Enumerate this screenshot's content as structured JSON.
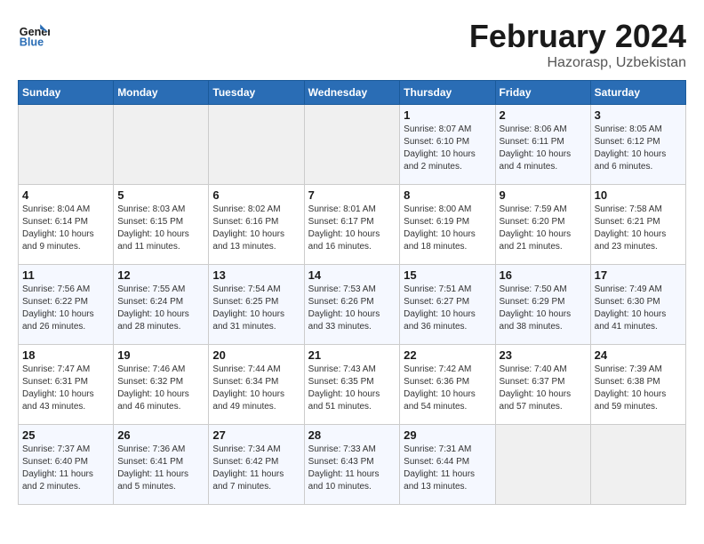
{
  "header": {
    "logo_general": "General",
    "logo_blue": "Blue",
    "month_title": "February 2024",
    "location": "Hazorasp, Uzbekistan"
  },
  "columns": [
    "Sunday",
    "Monday",
    "Tuesday",
    "Wednesday",
    "Thursday",
    "Friday",
    "Saturday"
  ],
  "weeks": [
    {
      "days": [
        {
          "num": "",
          "info": "",
          "empty": true
        },
        {
          "num": "",
          "info": "",
          "empty": true
        },
        {
          "num": "",
          "info": "",
          "empty": true
        },
        {
          "num": "",
          "info": "",
          "empty": true
        },
        {
          "num": "1",
          "info": "Sunrise: 8:07 AM\nSunset: 6:10 PM\nDaylight: 10 hours and 2 minutes."
        },
        {
          "num": "2",
          "info": "Sunrise: 8:06 AM\nSunset: 6:11 PM\nDaylight: 10 hours and 4 minutes."
        },
        {
          "num": "3",
          "info": "Sunrise: 8:05 AM\nSunset: 6:12 PM\nDaylight: 10 hours and 6 minutes."
        }
      ]
    },
    {
      "days": [
        {
          "num": "4",
          "info": "Sunrise: 8:04 AM\nSunset: 6:14 PM\nDaylight: 10 hours and 9 minutes."
        },
        {
          "num": "5",
          "info": "Sunrise: 8:03 AM\nSunset: 6:15 PM\nDaylight: 10 hours and 11 minutes."
        },
        {
          "num": "6",
          "info": "Sunrise: 8:02 AM\nSunset: 6:16 PM\nDaylight: 10 hours and 13 minutes."
        },
        {
          "num": "7",
          "info": "Sunrise: 8:01 AM\nSunset: 6:17 PM\nDaylight: 10 hours and 16 minutes."
        },
        {
          "num": "8",
          "info": "Sunrise: 8:00 AM\nSunset: 6:19 PM\nDaylight: 10 hours and 18 minutes."
        },
        {
          "num": "9",
          "info": "Sunrise: 7:59 AM\nSunset: 6:20 PM\nDaylight: 10 hours and 21 minutes."
        },
        {
          "num": "10",
          "info": "Sunrise: 7:58 AM\nSunset: 6:21 PM\nDaylight: 10 hours and 23 minutes."
        }
      ]
    },
    {
      "days": [
        {
          "num": "11",
          "info": "Sunrise: 7:56 AM\nSunset: 6:22 PM\nDaylight: 10 hours and 26 minutes."
        },
        {
          "num": "12",
          "info": "Sunrise: 7:55 AM\nSunset: 6:24 PM\nDaylight: 10 hours and 28 minutes."
        },
        {
          "num": "13",
          "info": "Sunrise: 7:54 AM\nSunset: 6:25 PM\nDaylight: 10 hours and 31 minutes."
        },
        {
          "num": "14",
          "info": "Sunrise: 7:53 AM\nSunset: 6:26 PM\nDaylight: 10 hours and 33 minutes."
        },
        {
          "num": "15",
          "info": "Sunrise: 7:51 AM\nSunset: 6:27 PM\nDaylight: 10 hours and 36 minutes."
        },
        {
          "num": "16",
          "info": "Sunrise: 7:50 AM\nSunset: 6:29 PM\nDaylight: 10 hours and 38 minutes."
        },
        {
          "num": "17",
          "info": "Sunrise: 7:49 AM\nSunset: 6:30 PM\nDaylight: 10 hours and 41 minutes."
        }
      ]
    },
    {
      "days": [
        {
          "num": "18",
          "info": "Sunrise: 7:47 AM\nSunset: 6:31 PM\nDaylight: 10 hours and 43 minutes."
        },
        {
          "num": "19",
          "info": "Sunrise: 7:46 AM\nSunset: 6:32 PM\nDaylight: 10 hours and 46 minutes."
        },
        {
          "num": "20",
          "info": "Sunrise: 7:44 AM\nSunset: 6:34 PM\nDaylight: 10 hours and 49 minutes."
        },
        {
          "num": "21",
          "info": "Sunrise: 7:43 AM\nSunset: 6:35 PM\nDaylight: 10 hours and 51 minutes."
        },
        {
          "num": "22",
          "info": "Sunrise: 7:42 AM\nSunset: 6:36 PM\nDaylight: 10 hours and 54 minutes."
        },
        {
          "num": "23",
          "info": "Sunrise: 7:40 AM\nSunset: 6:37 PM\nDaylight: 10 hours and 57 minutes."
        },
        {
          "num": "24",
          "info": "Sunrise: 7:39 AM\nSunset: 6:38 PM\nDaylight: 10 hours and 59 minutes."
        }
      ]
    },
    {
      "days": [
        {
          "num": "25",
          "info": "Sunrise: 7:37 AM\nSunset: 6:40 PM\nDaylight: 11 hours and 2 minutes."
        },
        {
          "num": "26",
          "info": "Sunrise: 7:36 AM\nSunset: 6:41 PM\nDaylight: 11 hours and 5 minutes."
        },
        {
          "num": "27",
          "info": "Sunrise: 7:34 AM\nSunset: 6:42 PM\nDaylight: 11 hours and 7 minutes."
        },
        {
          "num": "28",
          "info": "Sunrise: 7:33 AM\nSunset: 6:43 PM\nDaylight: 11 hours and 10 minutes."
        },
        {
          "num": "29",
          "info": "Sunrise: 7:31 AM\nSunset: 6:44 PM\nDaylight: 11 hours and 13 minutes."
        },
        {
          "num": "",
          "info": "",
          "empty": true
        },
        {
          "num": "",
          "info": "",
          "empty": true
        }
      ]
    }
  ]
}
